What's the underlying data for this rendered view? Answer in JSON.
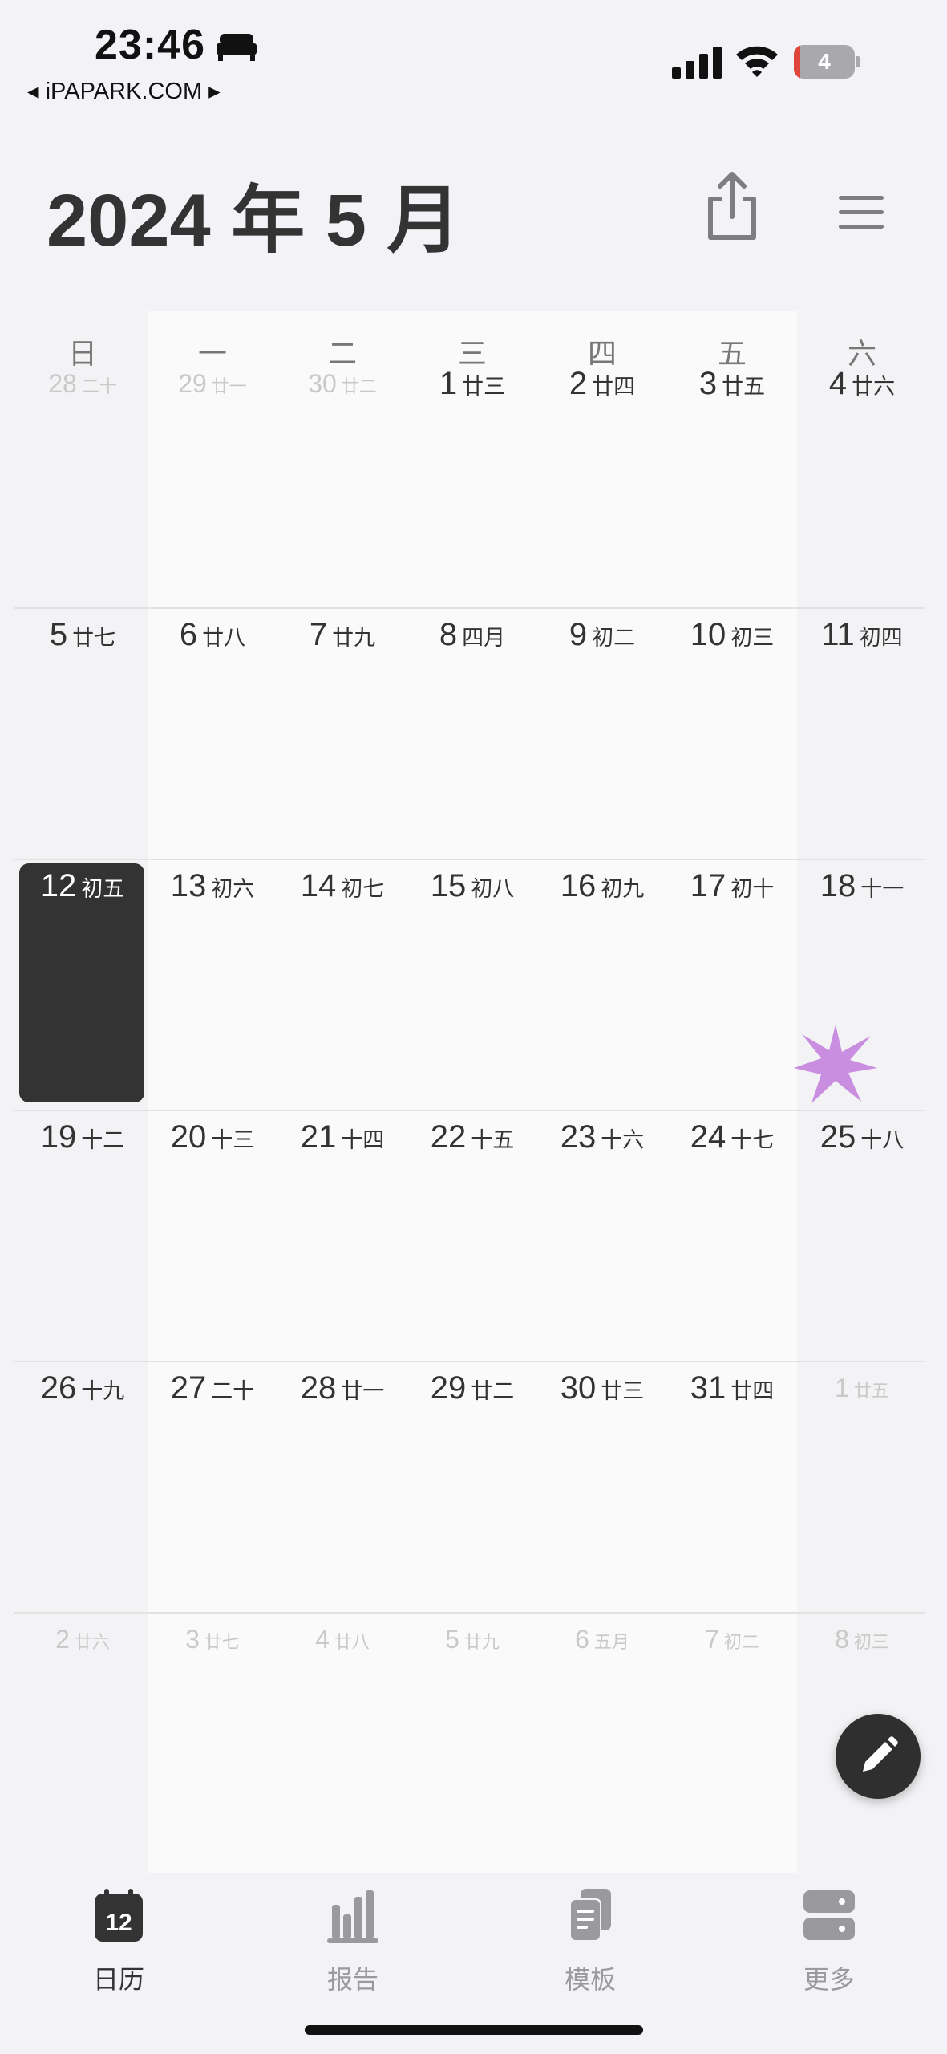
{
  "status_bar": {
    "time": "23:46",
    "back_app": "◂ iPAPARK.COM ▸",
    "battery_level": "4",
    "battery_fraction": 0.04
  },
  "header": {
    "title": "2024 年 5 月"
  },
  "weekdays": [
    "日",
    "一",
    "二",
    "三",
    "四",
    "五",
    "六"
  ],
  "weeks": [
    [
      {
        "day": "28",
        "lunar": "二十",
        "outside": true
      },
      {
        "day": "29",
        "lunar": "廿一",
        "outside": true
      },
      {
        "day": "30",
        "lunar": "廿二",
        "outside": true
      },
      {
        "day": "1",
        "lunar": "廿三"
      },
      {
        "day": "2",
        "lunar": "廿四"
      },
      {
        "day": "3",
        "lunar": "廿五"
      },
      {
        "day": "4",
        "lunar": "廿六"
      }
    ],
    [
      {
        "day": "5",
        "lunar": "廿七"
      },
      {
        "day": "6",
        "lunar": "廿八"
      },
      {
        "day": "7",
        "lunar": "廿九"
      },
      {
        "day": "8",
        "lunar": "四月"
      },
      {
        "day": "9",
        "lunar": "初二"
      },
      {
        "day": "10",
        "lunar": "初三"
      },
      {
        "day": "11",
        "lunar": "初四"
      }
    ],
    [
      {
        "day": "12",
        "lunar": "初五",
        "today": true
      },
      {
        "day": "13",
        "lunar": "初六"
      },
      {
        "day": "14",
        "lunar": "初七"
      },
      {
        "day": "15",
        "lunar": "初八"
      },
      {
        "day": "16",
        "lunar": "初九"
      },
      {
        "day": "17",
        "lunar": "初十"
      },
      {
        "day": "18",
        "lunar": "十一",
        "marker": "sparkle-icon"
      }
    ],
    [
      {
        "day": "19",
        "lunar": "十二"
      },
      {
        "day": "20",
        "lunar": "十三"
      },
      {
        "day": "21",
        "lunar": "十四"
      },
      {
        "day": "22",
        "lunar": "十五"
      },
      {
        "day": "23",
        "lunar": "十六"
      },
      {
        "day": "24",
        "lunar": "十七"
      },
      {
        "day": "25",
        "lunar": "十八"
      }
    ],
    [
      {
        "day": "26",
        "lunar": "十九"
      },
      {
        "day": "27",
        "lunar": "二十"
      },
      {
        "day": "28",
        "lunar": "廿一"
      },
      {
        "day": "29",
        "lunar": "廿二"
      },
      {
        "day": "30",
        "lunar": "廿三"
      },
      {
        "day": "31",
        "lunar": "廿四"
      },
      {
        "day": "1",
        "lunar": "廿五",
        "outside": true
      }
    ],
    [
      {
        "day": "2",
        "lunar": "廿六",
        "outside": true
      },
      {
        "day": "3",
        "lunar": "廿七",
        "outside": true
      },
      {
        "day": "4",
        "lunar": "廿八",
        "outside": true
      },
      {
        "day": "5",
        "lunar": "廿九",
        "outside": true
      },
      {
        "day": "6",
        "lunar": "五月",
        "outside": true
      },
      {
        "day": "7",
        "lunar": "初二",
        "outside": true
      },
      {
        "day": "8",
        "lunar": "初三",
        "outside": true
      }
    ]
  ],
  "tabs": [
    {
      "label": "日历",
      "icon": "calendar-icon",
      "icon_text": "12",
      "active": true
    },
    {
      "label": "报告",
      "icon": "chart-bar-icon"
    },
    {
      "label": "模板",
      "icon": "template-icon"
    },
    {
      "label": "更多",
      "icon": "more-icon"
    }
  ],
  "colors": {
    "background": "#f2f2f7",
    "today_bg": "#333333",
    "active_tab": "#333333",
    "inactive_tab": "#9a9a9e",
    "sparkle": "#c98ee0",
    "battery_low": "#e0453a"
  }
}
